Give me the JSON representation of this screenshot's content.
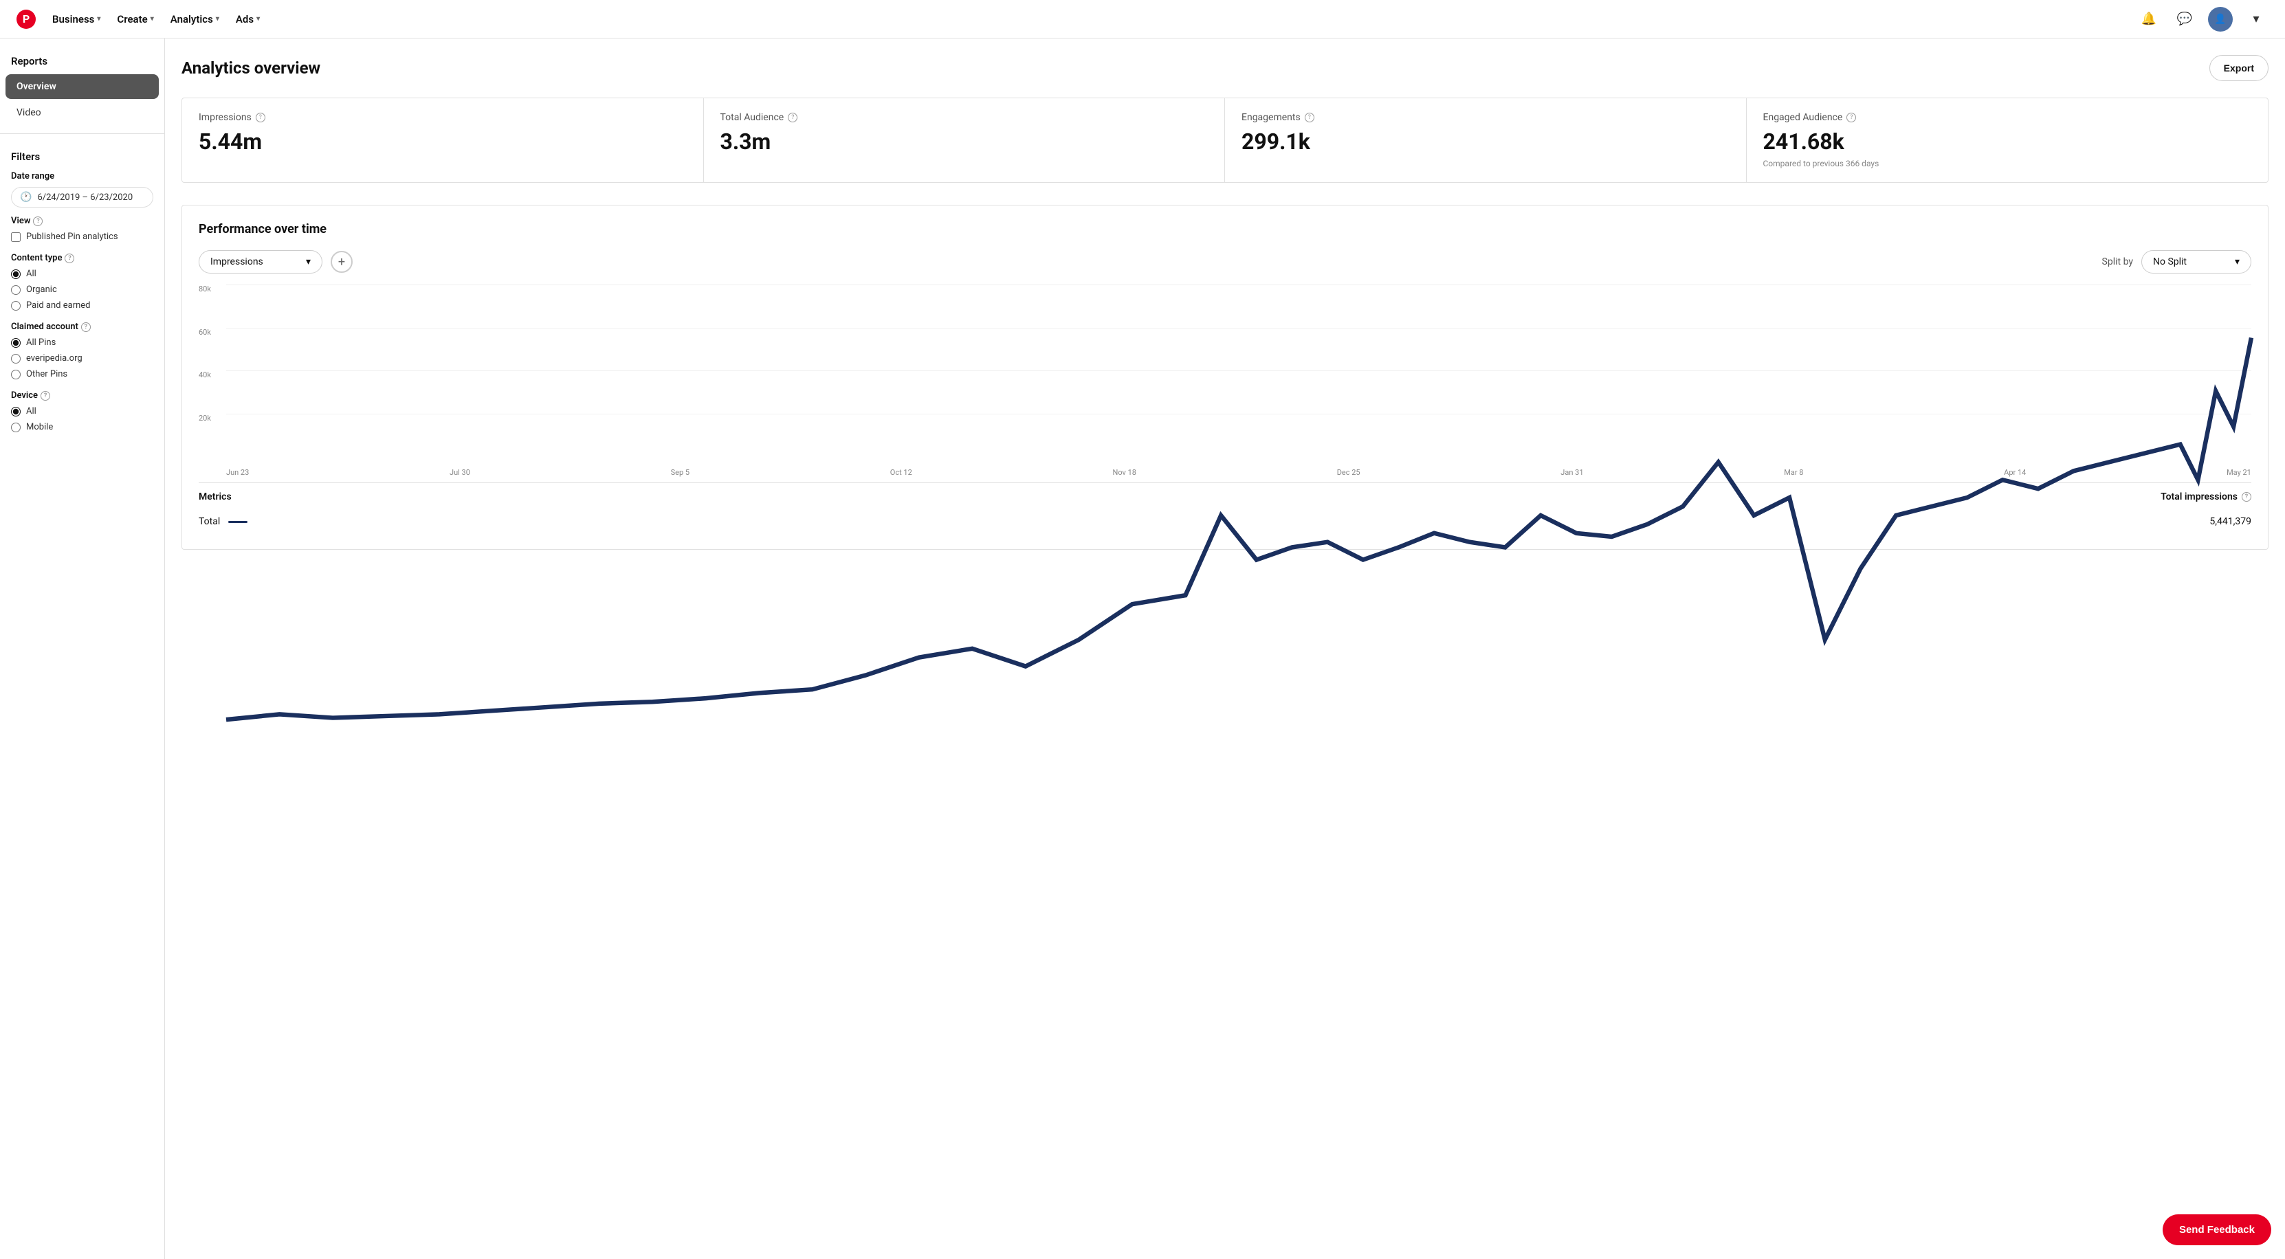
{
  "nav": {
    "logo_letter": "P",
    "items": [
      {
        "label": "Business",
        "id": "business"
      },
      {
        "label": "Create",
        "id": "create"
      },
      {
        "label": "Analytics",
        "id": "analytics"
      },
      {
        "label": "Ads",
        "id": "ads"
      }
    ],
    "export_label": "Export"
  },
  "page": {
    "title": "Analytics overview",
    "export_label": "Export"
  },
  "stats": [
    {
      "id": "impressions",
      "label": "Impressions",
      "value": "5.44m",
      "sub": ""
    },
    {
      "id": "total_audience",
      "label": "Total Audience",
      "value": "3.3m",
      "sub": ""
    },
    {
      "id": "engagements",
      "label": "Engagements",
      "value": "299.1k",
      "sub": ""
    },
    {
      "id": "engaged_audience",
      "label": "Engaged Audience",
      "value": "241.68k",
      "sub": "Compared to previous 366 days"
    }
  ],
  "chart": {
    "title": "Performance over time",
    "metric_label": "Impressions",
    "add_metric_tooltip": "+",
    "split_label": "Split by",
    "split_value": "No Split",
    "y_labels": [
      "80k",
      "60k",
      "40k",
      "20k",
      ""
    ],
    "x_labels": [
      "Jun 23",
      "Jul 30",
      "Sep 5",
      "Oct 12",
      "Nov 18",
      "Dec 25",
      "Jan 31",
      "Mar 8",
      "Apr 14",
      "May 21"
    ],
    "metrics_header": "Metrics",
    "total_impressions_label": "Total impressions",
    "metrics_rows": [
      {
        "name": "Total",
        "value": "5,441,379"
      }
    ]
  },
  "sidebar": {
    "reports_label": "Reports",
    "nav_items": [
      {
        "label": "Overview",
        "active": true
      },
      {
        "label": "Video",
        "active": false
      }
    ],
    "filters_label": "Filters",
    "date_range_label": "Date range",
    "date_range_value": "6/24/2019 – 6/23/2020",
    "view_label": "View",
    "published_pin_label": "Published Pin analytics",
    "content_type_label": "Content type",
    "content_type_options": [
      {
        "label": "All",
        "value": "all",
        "checked": true
      },
      {
        "label": "Organic",
        "value": "organic",
        "checked": false
      },
      {
        "label": "Paid and earned",
        "value": "paid_earned",
        "checked": false
      }
    ],
    "claimed_account_label": "Claimed account",
    "claimed_account_options": [
      {
        "label": "All Pins",
        "value": "all",
        "checked": true
      },
      {
        "label": "everipedia.org",
        "value": "everipedia",
        "checked": false
      },
      {
        "label": "Other Pins",
        "value": "other",
        "checked": false
      }
    ],
    "device_label": "Device",
    "device_options": [
      {
        "label": "All",
        "value": "all",
        "checked": true
      },
      {
        "label": "Mobile",
        "value": "mobile",
        "checked": false
      }
    ]
  },
  "feedback": {
    "label": "Send Feedback"
  }
}
